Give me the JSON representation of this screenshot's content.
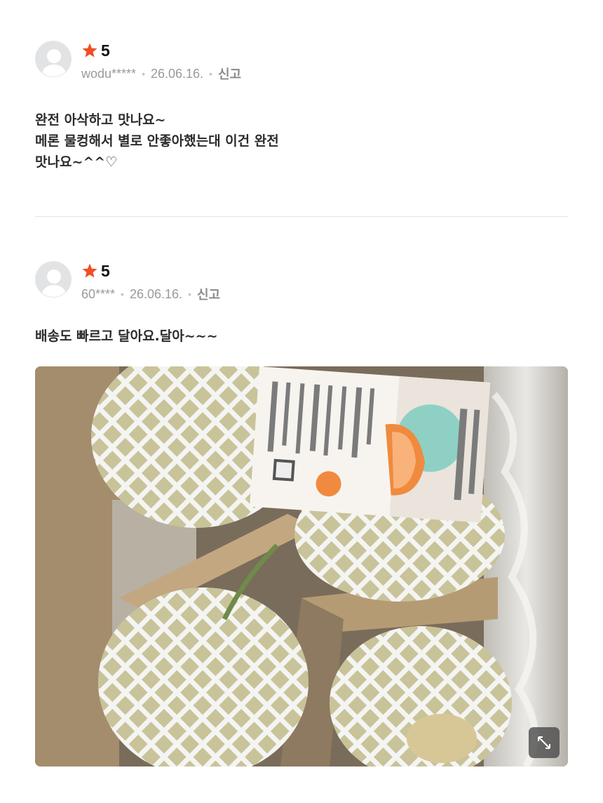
{
  "colors": {
    "star": "#f04e23",
    "text": "#2b2b2b",
    "meta": "#9a9a9a"
  },
  "reviews": [
    {
      "rating": "5",
      "user": "wodu*****",
      "date": "26.06.16.",
      "report_label": "신고",
      "content": "완전 아삭하고 맛나요~\n메론 물컹해서 별로 안좋아했는대 이건 완전\n맛나요~^^♡"
    },
    {
      "rating": "5",
      "user": "60****",
      "date": "26.06.16.",
      "report_label": "신고",
      "content": "배송도 빠르고 달아요.달아~~~",
      "photo_icon": "expand-icon"
    }
  ]
}
